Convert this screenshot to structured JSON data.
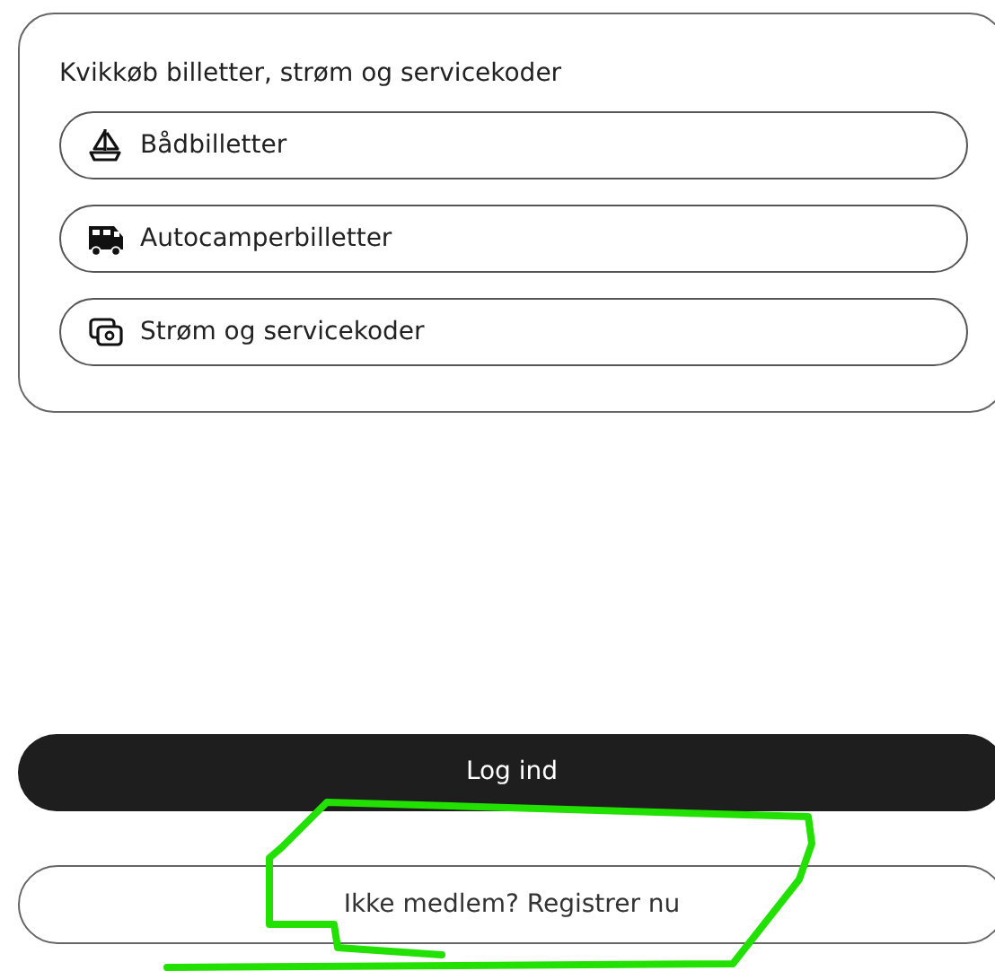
{
  "quick_buy": {
    "heading": "Kvikkøb billetter, strøm og servicekoder",
    "buttons": [
      {
        "kind": "boat",
        "label": "Bådbilletter"
      },
      {
        "kind": "camper",
        "label": "Autocamperbilletter"
      },
      {
        "kind": "code",
        "label": "Strøm og servicekoder"
      }
    ]
  },
  "login_button": "Log ind",
  "register_button": "Ikke medlem? Registrer nu"
}
